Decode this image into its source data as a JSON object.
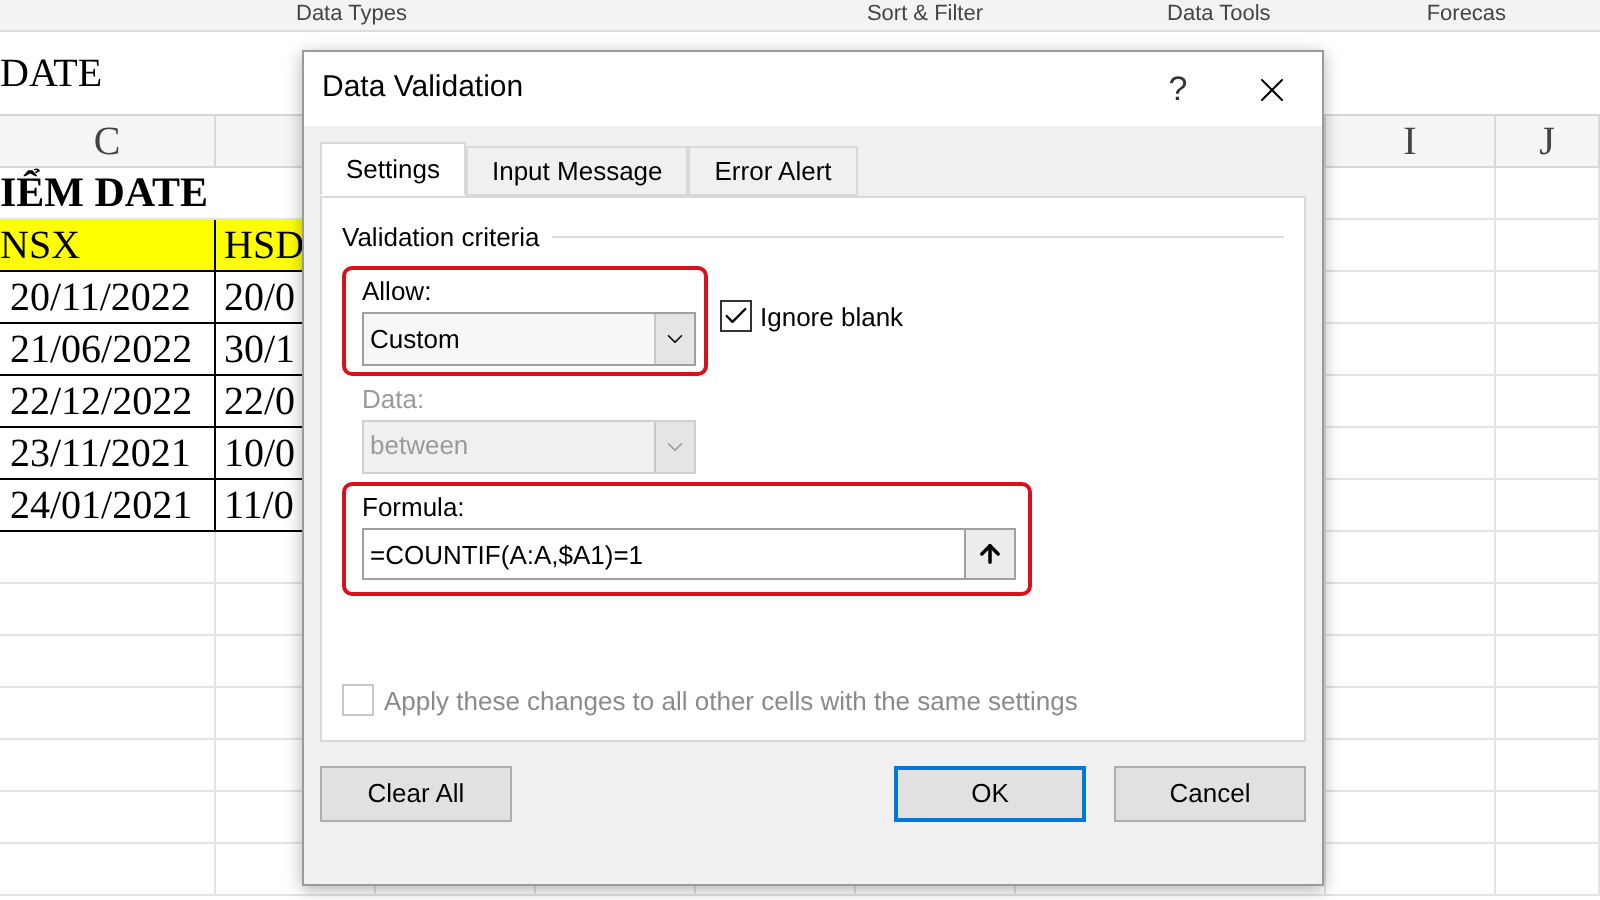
{
  "ribbon_groups": [
    "Data Types",
    "Sort & Filter",
    "Data Tools",
    "Forecas"
  ],
  "formula_bar": {
    "value": "DATE"
  },
  "sheet": {
    "column_headers": [
      {
        "label": "C"
      },
      {
        "label": "I"
      },
      {
        "label": "J"
      }
    ],
    "rows": [
      {
        "kind": "title",
        "cells": [
          "IỂM DATE"
        ]
      },
      {
        "kind": "header",
        "cells": [
          "NSX",
          "HSD"
        ]
      },
      {
        "kind": "data",
        "cells": [
          "20/11/2022",
          "20/0"
        ]
      },
      {
        "kind": "data",
        "cells": [
          "21/06/2022",
          "30/1"
        ]
      },
      {
        "kind": "data",
        "cells": [
          "22/12/2022",
          "22/0"
        ]
      },
      {
        "kind": "data",
        "cells": [
          "23/11/2021",
          "10/0"
        ]
      },
      {
        "kind": "data",
        "cells": [
          "24/01/2021",
          "11/0"
        ]
      }
    ]
  },
  "dialog": {
    "title": "Data Validation",
    "help": "?",
    "tabs": [
      {
        "label": "Settings",
        "selected": true
      },
      {
        "label": "Input Message",
        "selected": false
      },
      {
        "label": "Error Alert",
        "selected": false
      }
    ],
    "group_title": "Validation criteria",
    "allow": {
      "label": "Allow:",
      "value": "Custom",
      "disabled": false,
      "highlighted": true
    },
    "ignore_blank": {
      "label": "Ignore blank",
      "checked": true,
      "disabled": false
    },
    "data": {
      "label": "Data:",
      "value": "between",
      "disabled": true
    },
    "formula": {
      "label": "Formula:",
      "value": "=COUNTIF(A:A,$A1)=1",
      "highlighted": true
    },
    "apply_all": {
      "label": "Apply these changes to all other cells with the same settings",
      "checked": false,
      "disabled": true
    },
    "buttons": [
      {
        "label": "Clear All",
        "default": false
      },
      {
        "label": "OK",
        "default": true
      },
      {
        "label": "Cancel",
        "default": false
      }
    ]
  }
}
